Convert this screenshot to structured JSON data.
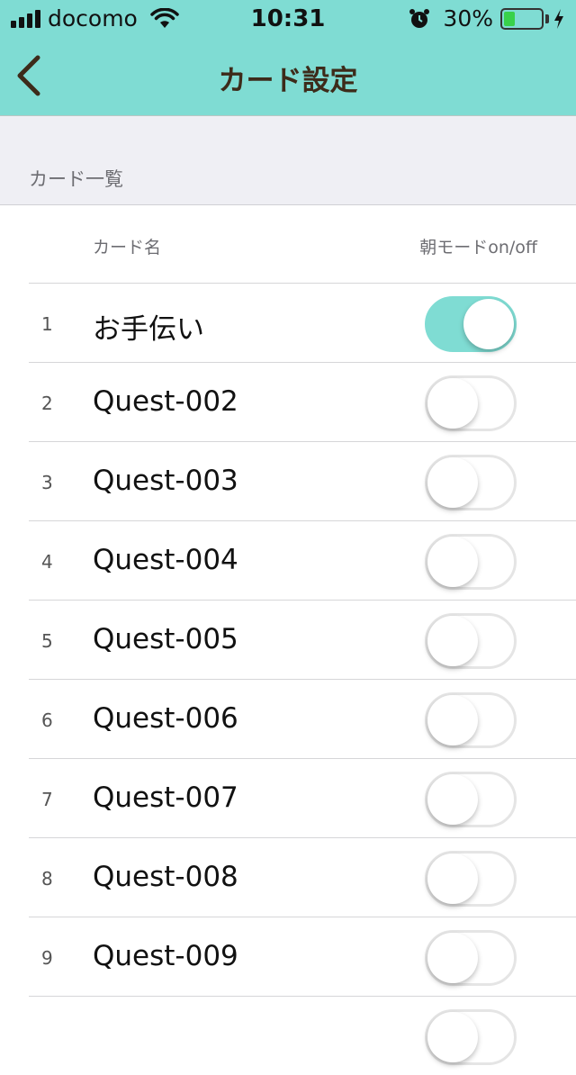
{
  "status_bar": {
    "carrier": "docomo",
    "time": "10:31",
    "battery_percent": "30%",
    "battery_level": 0.3
  },
  "nav": {
    "title": "カード設定",
    "back_icon": "chevron-left-icon"
  },
  "section": {
    "title": "カード一覧"
  },
  "columns": {
    "name": "カード名",
    "mode": "朝モードon/off"
  },
  "cards": [
    {
      "index": "1",
      "name": "お手伝い",
      "on": true
    },
    {
      "index": "2",
      "name": "Quest-002",
      "on": false
    },
    {
      "index": "3",
      "name": "Quest-003",
      "on": false
    },
    {
      "index": "4",
      "name": "Quest-004",
      "on": false
    },
    {
      "index": "5",
      "name": "Quest-005",
      "on": false
    },
    {
      "index": "6",
      "name": "Quest-006",
      "on": false
    },
    {
      "index": "7",
      "name": "Quest-007",
      "on": false
    },
    {
      "index": "8",
      "name": "Quest-008",
      "on": false
    },
    {
      "index": "9",
      "name": "Quest-009",
      "on": false
    },
    {
      "index": "",
      "name": "",
      "on": false
    }
  ],
  "colors": {
    "accent": "#7fdcd3",
    "title_text": "#3d2b1a"
  }
}
